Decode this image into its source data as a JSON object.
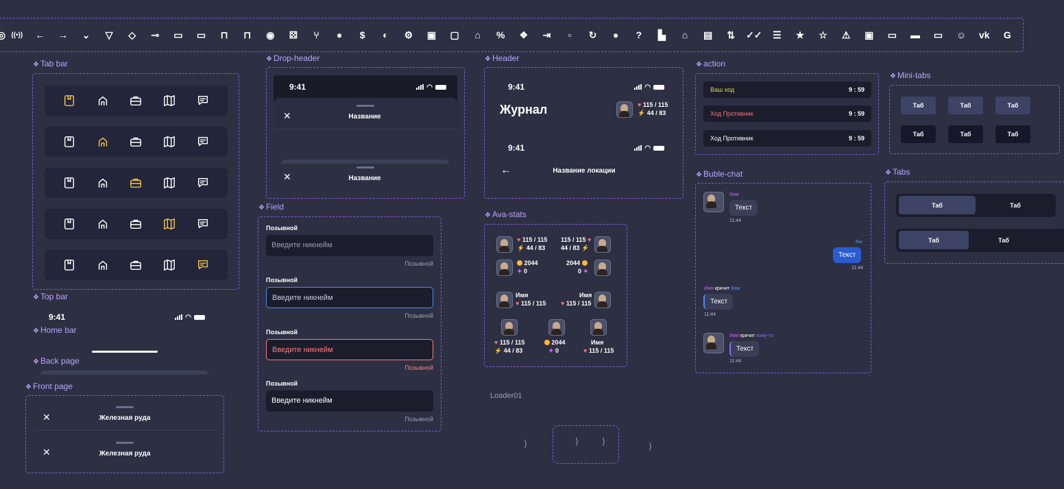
{
  "icons_row": [
    "broadcast-icon",
    "arrow-left-icon",
    "arrow-right-icon",
    "chevron-down-icon",
    "filter-icon",
    "drop-icon",
    "key-icon",
    "chat-icon",
    "chat-double-icon",
    "lock-icon",
    "unlock-icon",
    "eye-outline-icon",
    "dice-icon",
    "fork-icon",
    "eye-icon",
    "dollar-icon",
    "brain-icon",
    "gear-icon",
    "briefcase-icon",
    "book-icon",
    "house-icon",
    "percent-icon",
    "dropbox-icon",
    "login-icon",
    "box-icon",
    "refresh-icon",
    "pin-icon",
    "question-icon",
    "factory-icon",
    "home-icon",
    "shop-icon",
    "sort-icon",
    "double-check-icon",
    "list-icon",
    "star-icon",
    "star-outline-icon",
    "warning-icon",
    "id-icon",
    "toggle-off-icon",
    "toggle-on-icon",
    "battery-icon",
    "smile-icon",
    "vk-icon",
    "google-icon"
  ],
  "icons_row_glyphs": {
    "question-icon": "?",
    "dollar-icon": "$",
    "percent-icon": "%",
    "vk-icon": "vk",
    "google-icon": "G"
  },
  "sections": {
    "tab_bar": "Tab bar",
    "top_bar": "Top bar",
    "home_bar": "Home bar",
    "back_page": "Back page",
    "front_page": "Front page",
    "drop_header": "Drop-header",
    "field": "Field",
    "header": "Header",
    "ava_stats": "Ava-stats",
    "action": "action",
    "mini_tabs": "Mini-tabs",
    "buble_chat": "Buble-chat",
    "tabs": "Tabs"
  },
  "accent": "#f5c445",
  "status": {
    "time": "9:41"
  },
  "drop_header": {
    "title": "Название"
  },
  "front_page": {
    "title": "Железная руда"
  },
  "header": {
    "journal": "Журнал",
    "hp": "115 / 115",
    "energy": "44 / 83",
    "location": "Название локации"
  },
  "field": {
    "label": "Позывной",
    "placeholder": "Введите никнейм",
    "hint": "Позывной",
    "states": [
      "default",
      "focus",
      "error",
      "filled"
    ]
  },
  "ava_stats": {
    "hp": "115 / 115",
    "energy": "44 / 83",
    "coins": "2044",
    "gems": "0",
    "name": "Имя"
  },
  "action": [
    {
      "label": "Ваш ход",
      "time": "9 : 59",
      "color": "#d6d94a"
    },
    {
      "label": "Ход Противник",
      "time": "9 : 59",
      "color": "#ff6f6f"
    },
    {
      "label": "Ход Противник",
      "time": "9 : 59",
      "color": "#ffffff"
    }
  ],
  "mini_tabs": {
    "label": "Таб"
  },
  "chat": {
    "name": "Имя",
    "you": "Вы",
    "text": "Текст",
    "time": "11:44",
    "shouts": "кричит",
    "to_you": "Вам",
    "to_someone": "кому-то"
  },
  "tabs": {
    "label": "Таб"
  },
  "loader": {
    "label": "Loader01"
  }
}
